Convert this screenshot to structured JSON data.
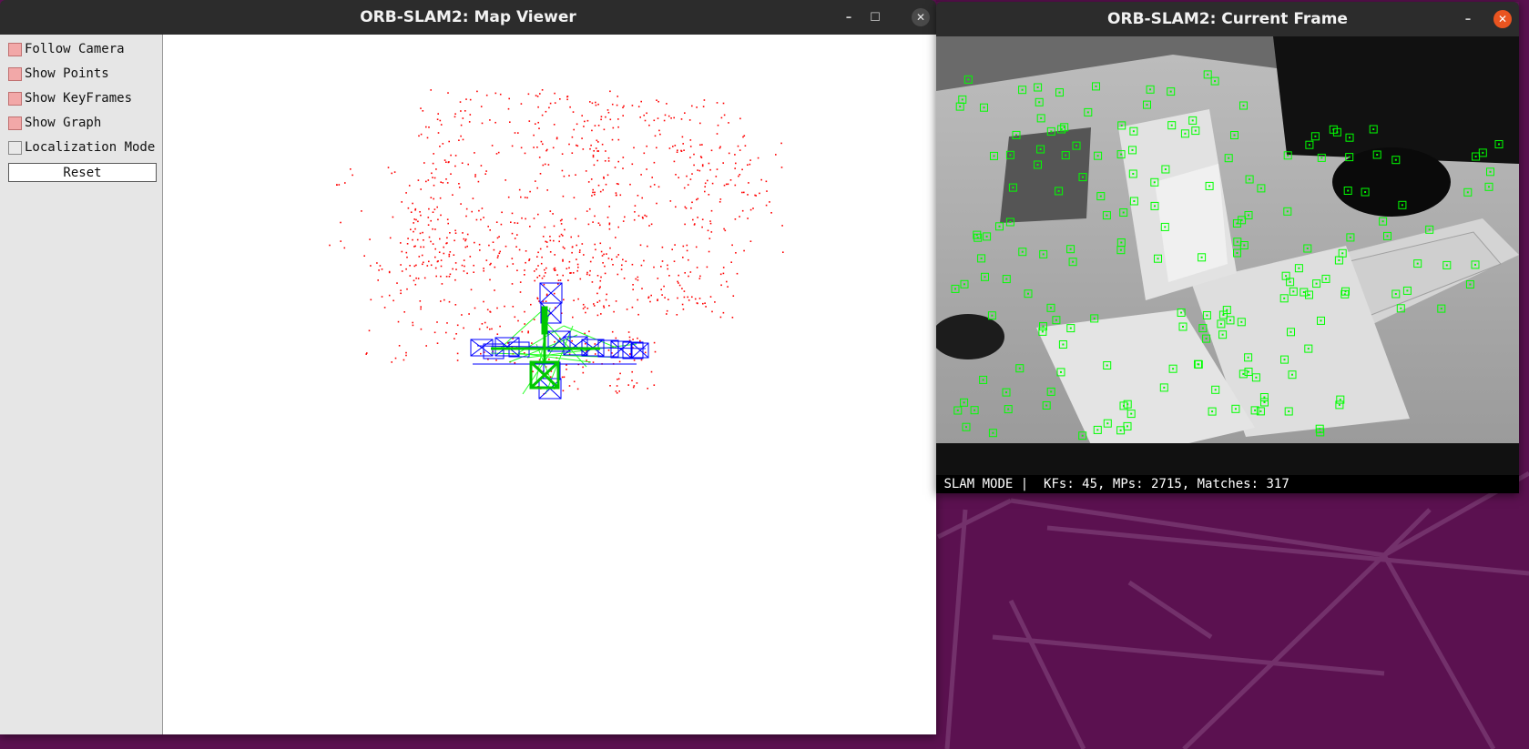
{
  "colors": {
    "wallpaper": "#5a1150",
    "titlebar": "#2c2c2c",
    "map_points": "#ff0000",
    "keyframes": "#0000ff",
    "graph": "#00ff00",
    "current_camera": "#00c800",
    "feature_boxes": "#00ff00",
    "close_active": "#e95420"
  },
  "map_viewer": {
    "title": "ORB-SLAM2: Map Viewer",
    "window_buttons": {
      "minimize": "–",
      "maximize": "☐",
      "close": "✕"
    },
    "panel": {
      "checkboxes": [
        {
          "label": "Follow Camera",
          "checked": true
        },
        {
          "label": "Show Points",
          "checked": true
        },
        {
          "label": "Show KeyFrames",
          "checked": true
        },
        {
          "label": "Show Graph",
          "checked": true
        },
        {
          "label": "Localization Mode",
          "checked": false
        }
      ],
      "reset_label": "Reset"
    }
  },
  "current_frame": {
    "title": "ORB-SLAM2: Current Frame",
    "window_buttons": {
      "minimize": "–",
      "close": "✕"
    },
    "status": {
      "mode": "SLAM MODE",
      "separator": "|",
      "stats": "KFs: 45, MPs: 2715, Matches: 317"
    }
  }
}
